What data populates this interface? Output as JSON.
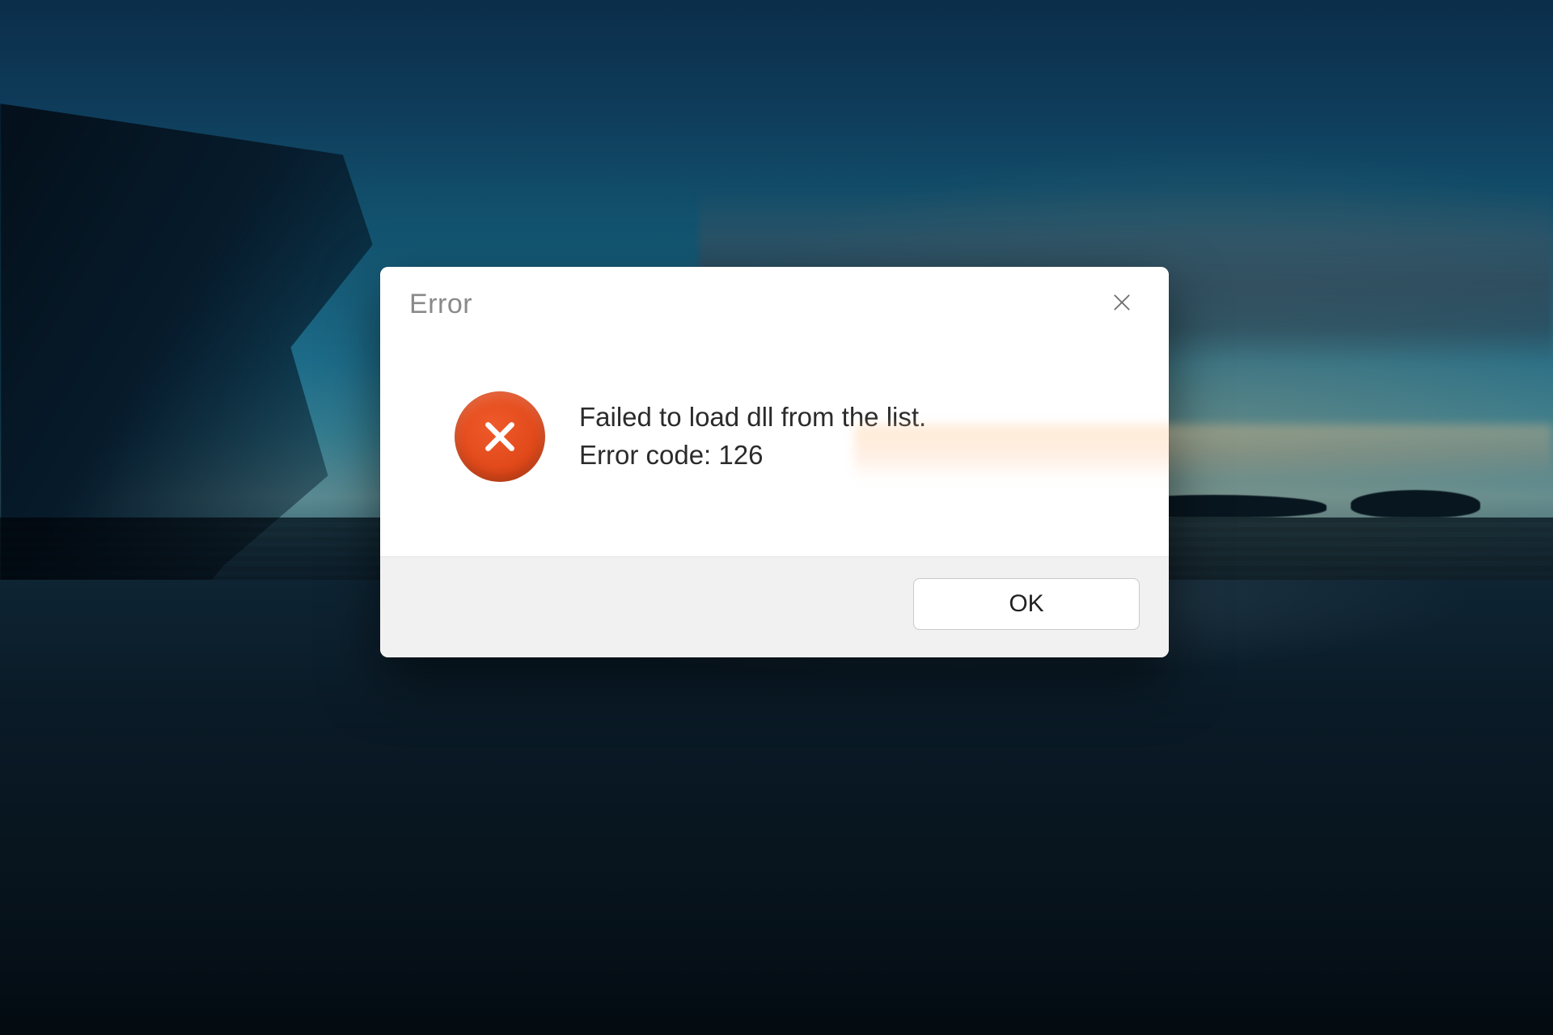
{
  "dialog": {
    "title": "Error",
    "message_line1": "Failed to load dll from the list.",
    "message_line2": "Error code: 126",
    "ok_label": "OK",
    "icon_color": "#e24a1b"
  }
}
